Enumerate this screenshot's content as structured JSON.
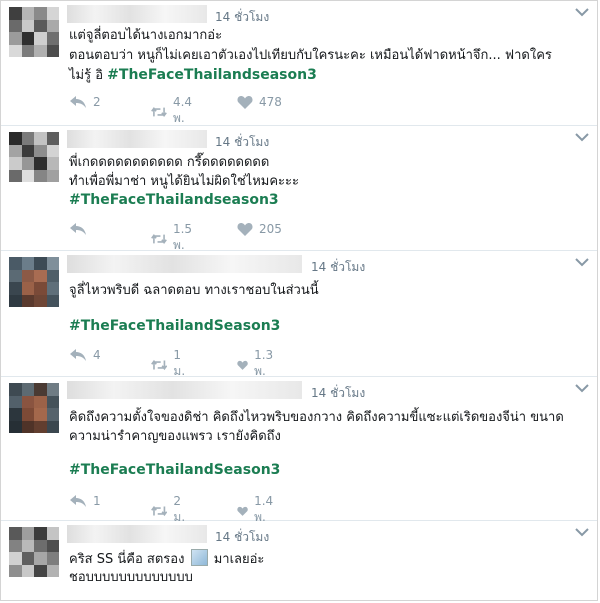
{
  "tweets": [
    {
      "time": "14 ชั่วโมง",
      "lines": [
        "แต่จูลี่ตอบได้นางเอกมากอ่ะ",
        "ตอนตอบว่า หนูก็ไม่เคยเอาตัวเองไปเทียบกับใครนะคะ เหมือนได้ฟาดหน้าจึก... ฟาดใคร",
        "ไม่รู้ อิ"
      ],
      "hashtag": "#TheFaceThailandseason3",
      "replies": "2",
      "retweets": "4.4 พ.",
      "likes": "478"
    },
    {
      "time": "14 ชั่วโมง",
      "lines": [
        "พี่เกดดดดดดดดดดด กรี๊ดดดดดดดด",
        "ทำเพื่อพี่มาช่า หนูได้ยินไม่ผิดใช่ไหมคะะะ"
      ],
      "hashtag": "#TheFaceThailandseason3",
      "replies": "",
      "retweets": "1.5 พ.",
      "likes": "205"
    },
    {
      "time": "14 ชั่วโมง",
      "lines": [
        "จูลี่ไหวพริบดี ฉลาดตอบ ทางเราชอบในส่วนนี้"
      ],
      "hashtag": "#TheFaceThailandSeason3",
      "replies": "4",
      "retweets": "1 ม.",
      "likes": "1.3 พ."
    },
    {
      "time": "14 ชั่วโมง",
      "lines": [
        "คิดถึงความตั้งใจของดิช่า คิดถึงไหวพริบของกวาง คิดถึงความขี้แซะแต่เริดของจีน่า ขนาด",
        "ความน่ารำคาญของแพรว เรายังคิดถึง"
      ],
      "hashtag": "#TheFaceThailandSeason3",
      "replies": "1",
      "retweets": "2 ม.",
      "likes": "1.4 พ."
    },
    {
      "time": "14 ชั่วโมง",
      "line1_before": "คริส SS นี่คือ สตรอง",
      "line1_after": "มาเลยอ่ะ",
      "line2": "ชอบบบบบบบบบบบบบ"
    }
  ],
  "icons": [
    "reply-icon",
    "retweet-icon",
    "like-icon",
    "chevron-down-icon",
    "broken-image-icon"
  ],
  "colors": {
    "hashtag": "#1b7d52",
    "meta": "#657786",
    "action": "#8899a6"
  }
}
